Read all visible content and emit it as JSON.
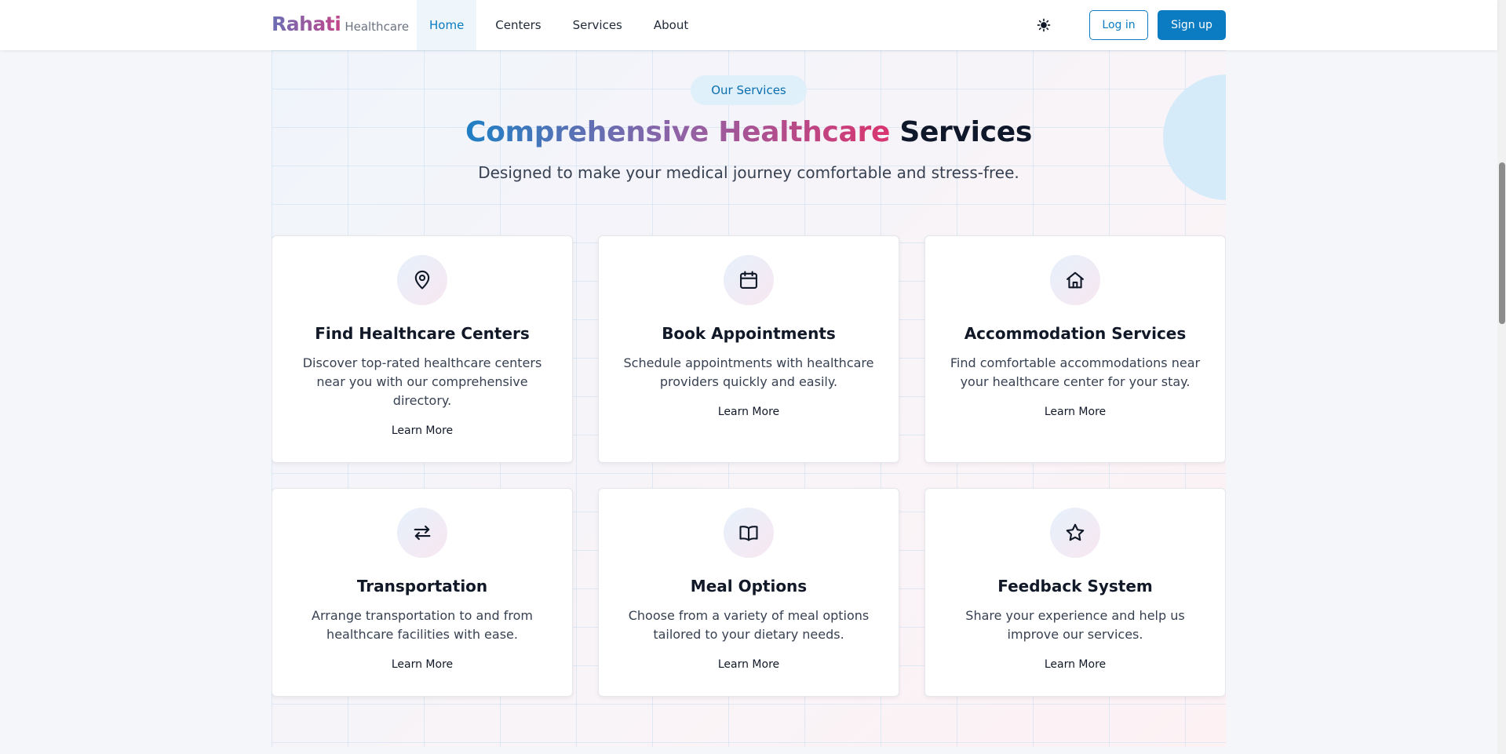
{
  "nav": {
    "brand_name": "Rahati",
    "brand_sub": "Healthcare",
    "links": [
      {
        "label": "Home",
        "active": true
      },
      {
        "label": "Centers",
        "active": false
      },
      {
        "label": "Services",
        "active": false
      },
      {
        "label": "About",
        "active": false
      }
    ],
    "theme_icon": "sun-icon",
    "login_label": "Log in",
    "signup_label": "Sign up"
  },
  "section": {
    "pill": "Our Services",
    "heading_gradient": "Comprehensive Healthcare",
    "heading_plain": "Services",
    "subtitle": "Designed to make your medical journey comfortable and stress-free."
  },
  "cards": [
    {
      "icon": "map-pin-icon",
      "title": "Find Healthcare Centers",
      "desc": "Discover top-rated healthcare centers near you with our comprehensive directory.",
      "link": "Learn More"
    },
    {
      "icon": "calendar-icon",
      "title": "Book Appointments",
      "desc": "Schedule appointments with healthcare providers quickly and easily.",
      "link": "Learn More"
    },
    {
      "icon": "home-icon",
      "title": "Accommodation Services",
      "desc": "Find comfortable accommodations near your healthcare center for your stay.",
      "link": "Learn More"
    },
    {
      "icon": "arrows-exchange-icon",
      "title": "Transportation",
      "desc": "Arrange transportation to and from healthcare facilities with ease.",
      "link": "Learn More"
    },
    {
      "icon": "book-open-icon",
      "title": "Meal Options",
      "desc": "Choose from a variety of meal options tailored to your dietary needs.",
      "link": "Learn More"
    },
    {
      "icon": "star-icon",
      "title": "Feedback System",
      "desc": "Share your experience and help us improve our services.",
      "link": "Learn More"
    }
  ],
  "colors": {
    "primary": "#0b7cc1",
    "gradient_start": "#1f7fc4",
    "gradient_end": "#d9356f"
  }
}
